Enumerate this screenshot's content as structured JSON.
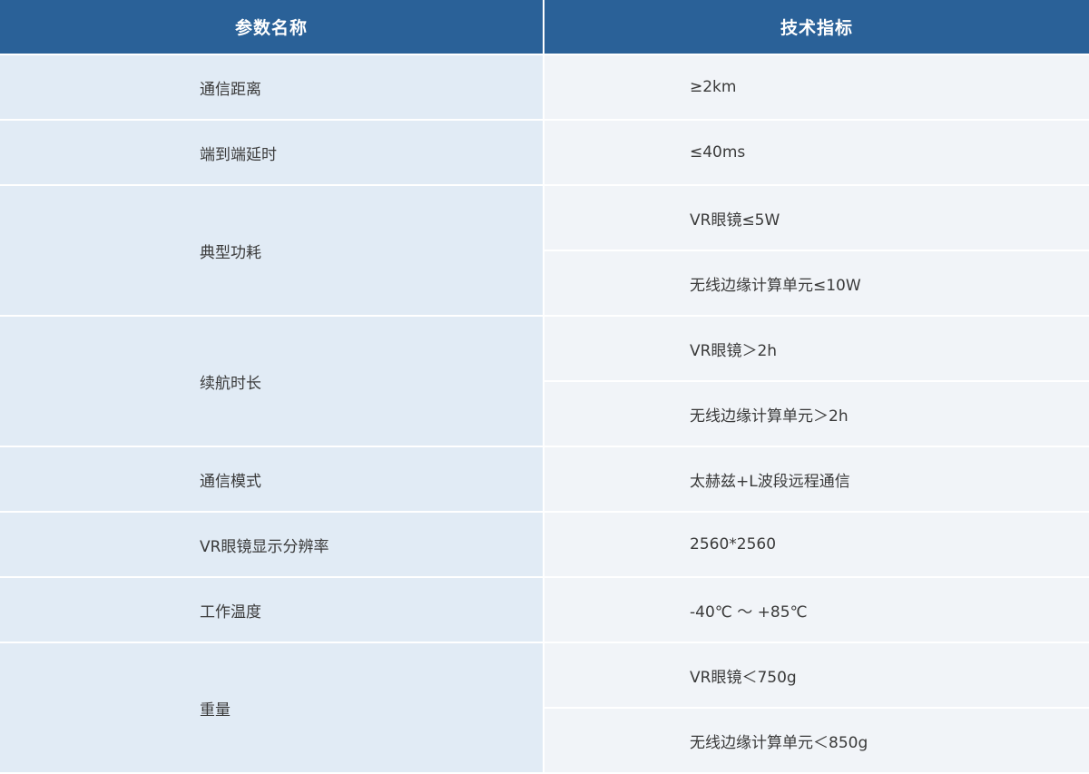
{
  "header": {
    "param_name": "参数名称",
    "spec": "技术指标"
  },
  "rows": [
    {
      "name": "通信距离",
      "values": [
        "≥2km"
      ]
    },
    {
      "name": "端到端延时",
      "values": [
        "≤40ms"
      ]
    },
    {
      "name": "典型功耗",
      "values": [
        "VR眼镜≤5W",
        "无线边缘计算单元≤10W"
      ]
    },
    {
      "name": "续航时长",
      "values": [
        "VR眼镜＞2h",
        "无线边缘计算单元＞2h"
      ]
    },
    {
      "name": "通信模式",
      "values": [
        "太赫兹+L波段远程通信"
      ]
    },
    {
      "name": "VR眼镜显示分辨率",
      "values": [
        "2560*2560"
      ]
    },
    {
      "name": "工作温度",
      "values": [
        "-40℃ ～ +85℃"
      ]
    },
    {
      "name": "重量",
      "values": [
        "VR眼镜＜750g",
        "无线边缘计算单元＜850g"
      ]
    }
  ],
  "colors": {
    "header_bg": "#2a6198",
    "name_bg": "#e1ebf5",
    "value_bg": "#f1f4f8",
    "text": "#3a3a3a"
  }
}
